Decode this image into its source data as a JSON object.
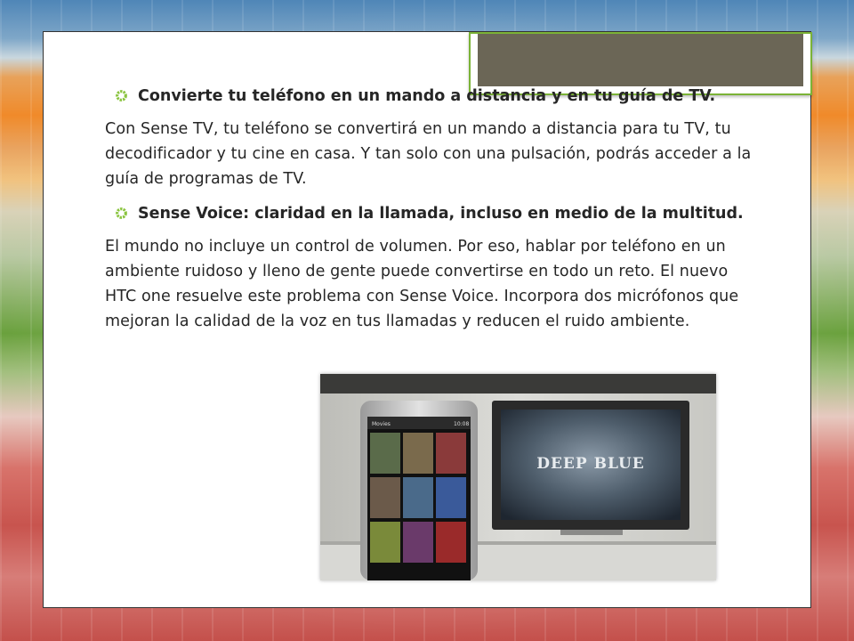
{
  "slide": {
    "bullets": [
      {
        "heading": "Convierte tu teléfono en un mando a distancia y en tu guía de TV.",
        "body": "Con Sense TV, tu teléfono se convertirá en un mando a distancia para tu TV, tu decodificador y tu cine en casa. Y tan solo con una pulsación, podrás acceder a la guía de programas de TV."
      },
      {
        "heading": "Sense Voice: claridad en la llamada, incluso en medio de la multitud.",
        "body": "El mundo no incluye un control de volumen. Por eso, hablar por teléfono en un ambiente ruidoso y lleno de gente puede convertirse en todo un reto. El nuevo HTC one resuelve este problema con Sense Voice. Incorpora dos micrófonos que mejoran la calidad de la voz en tus llamadas y reducen el ruido ambiente."
      }
    ],
    "photo": {
      "tv_title": "DEEP BLUE",
      "phone_header": "Movies",
      "phone_time": "10:08"
    }
  },
  "colors": {
    "accent": "#7bb336",
    "bullet": "#8ac43f",
    "text": "#262626"
  },
  "icons": {
    "bullet": "gear-bullet-icon"
  }
}
